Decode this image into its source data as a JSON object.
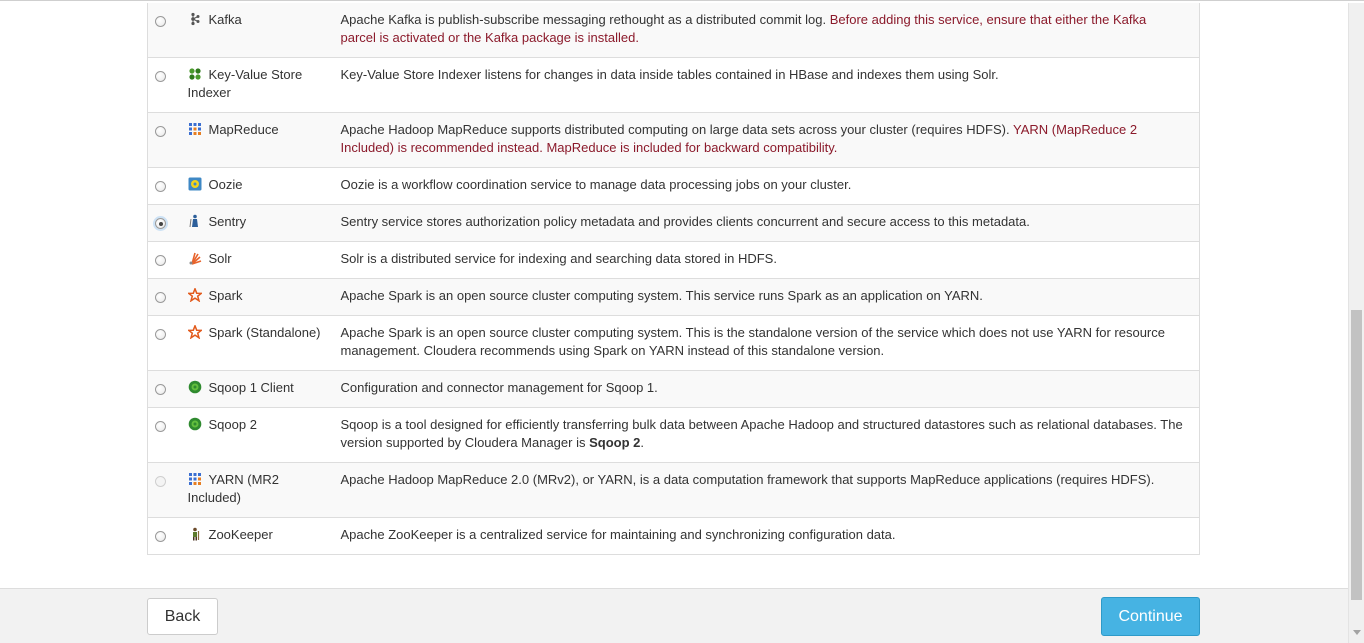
{
  "services": [
    {
      "id": "kafka",
      "name": "Kafka",
      "icon": "kafka-icon",
      "selected": false,
      "disabled": false,
      "desc": "Apache Kafka is publish-subscribe messaging rethought as a distributed commit log.",
      "warn": "Before adding this service, ensure that either the Kafka parcel is activated or the Kafka package is installed.",
      "desc_bold": "",
      "desc_tail": ""
    },
    {
      "id": "key-value-store-indexer",
      "name": "Key-Value Store Indexer",
      "icon": "key-value-store-icon",
      "selected": false,
      "disabled": false,
      "desc": "Key-Value Store Indexer listens for changes in data inside tables contained in HBase and indexes them using Solr.",
      "warn": "",
      "desc_bold": "",
      "desc_tail": ""
    },
    {
      "id": "mapreduce",
      "name": "MapReduce",
      "icon": "mapreduce-icon",
      "selected": false,
      "disabled": false,
      "desc": "Apache Hadoop MapReduce supports distributed computing on large data sets across your cluster (requires HDFS).",
      "warn": "YARN (MapReduce 2 Included) is recommended instead. MapReduce is included for backward compatibility.",
      "desc_bold": "",
      "desc_tail": ""
    },
    {
      "id": "oozie",
      "name": "Oozie",
      "icon": "oozie-icon",
      "selected": false,
      "disabled": false,
      "desc": "Oozie is a workflow coordination service to manage data processing jobs on your cluster.",
      "warn": "",
      "desc_bold": "",
      "desc_tail": ""
    },
    {
      "id": "sentry",
      "name": "Sentry",
      "icon": "sentry-icon",
      "selected": true,
      "disabled": false,
      "desc": "Sentry service stores authorization policy metadata and provides clients concurrent and secure access to this metadata.",
      "warn": "",
      "desc_bold": "",
      "desc_tail": ""
    },
    {
      "id": "solr",
      "name": "Solr",
      "icon": "solr-icon",
      "selected": false,
      "disabled": false,
      "desc": "Solr is a distributed service for indexing and searching data stored in HDFS.",
      "warn": "",
      "desc_bold": "",
      "desc_tail": ""
    },
    {
      "id": "spark",
      "name": "Spark",
      "icon": "spark-icon",
      "selected": false,
      "disabled": false,
      "desc": "Apache Spark is an open source cluster computing system. This service runs Spark as an application on YARN.",
      "warn": "",
      "desc_bold": "",
      "desc_tail": ""
    },
    {
      "id": "spark-standalone",
      "name": "Spark (Standalone)",
      "icon": "spark-icon",
      "selected": false,
      "disabled": false,
      "desc": "Apache Spark is an open source cluster computing system. This is the standalone version of the service which does not use YARN for resource management. Cloudera recommends using Spark on YARN instead of this standalone version.",
      "warn": "",
      "desc_bold": "",
      "desc_tail": ""
    },
    {
      "id": "sqoop1-client",
      "name": "Sqoop 1 Client",
      "icon": "sqoop-icon",
      "selected": false,
      "disabled": false,
      "desc": "Configuration and connector management for Sqoop 1.",
      "warn": "",
      "desc_bold": "",
      "desc_tail": ""
    },
    {
      "id": "sqoop2",
      "name": "Sqoop 2",
      "icon": "sqoop-icon",
      "selected": false,
      "disabled": false,
      "desc": "Sqoop is a tool designed for efficiently transferring bulk data between Apache Hadoop and structured datastores such as relational databases. The version supported by Cloudera Manager is ",
      "warn": "",
      "desc_bold": "Sqoop 2",
      "desc_tail": "."
    },
    {
      "id": "yarn",
      "name": "YARN (MR2 Included)",
      "icon": "yarn-icon",
      "selected": false,
      "disabled": true,
      "desc": "Apache Hadoop MapReduce 2.0 (MRv2), or YARN, is a data computation framework that supports MapReduce applications (requires HDFS).",
      "warn": "",
      "desc_bold": "",
      "desc_tail": ""
    },
    {
      "id": "zookeeper",
      "name": "ZooKeeper",
      "icon": "zookeeper-icon",
      "selected": false,
      "disabled": false,
      "desc": "Apache ZooKeeper is a centralized service for maintaining and synchronizing configuration data.",
      "warn": "",
      "desc_bold": "",
      "desc_tail": ""
    }
  ],
  "footer": {
    "back_label": "Back",
    "continue_label": "Continue"
  },
  "colors": {
    "warning_text": "#8b1a2b",
    "continue_button": "#46b3e3",
    "row_stripe": "#f9f9f9"
  }
}
